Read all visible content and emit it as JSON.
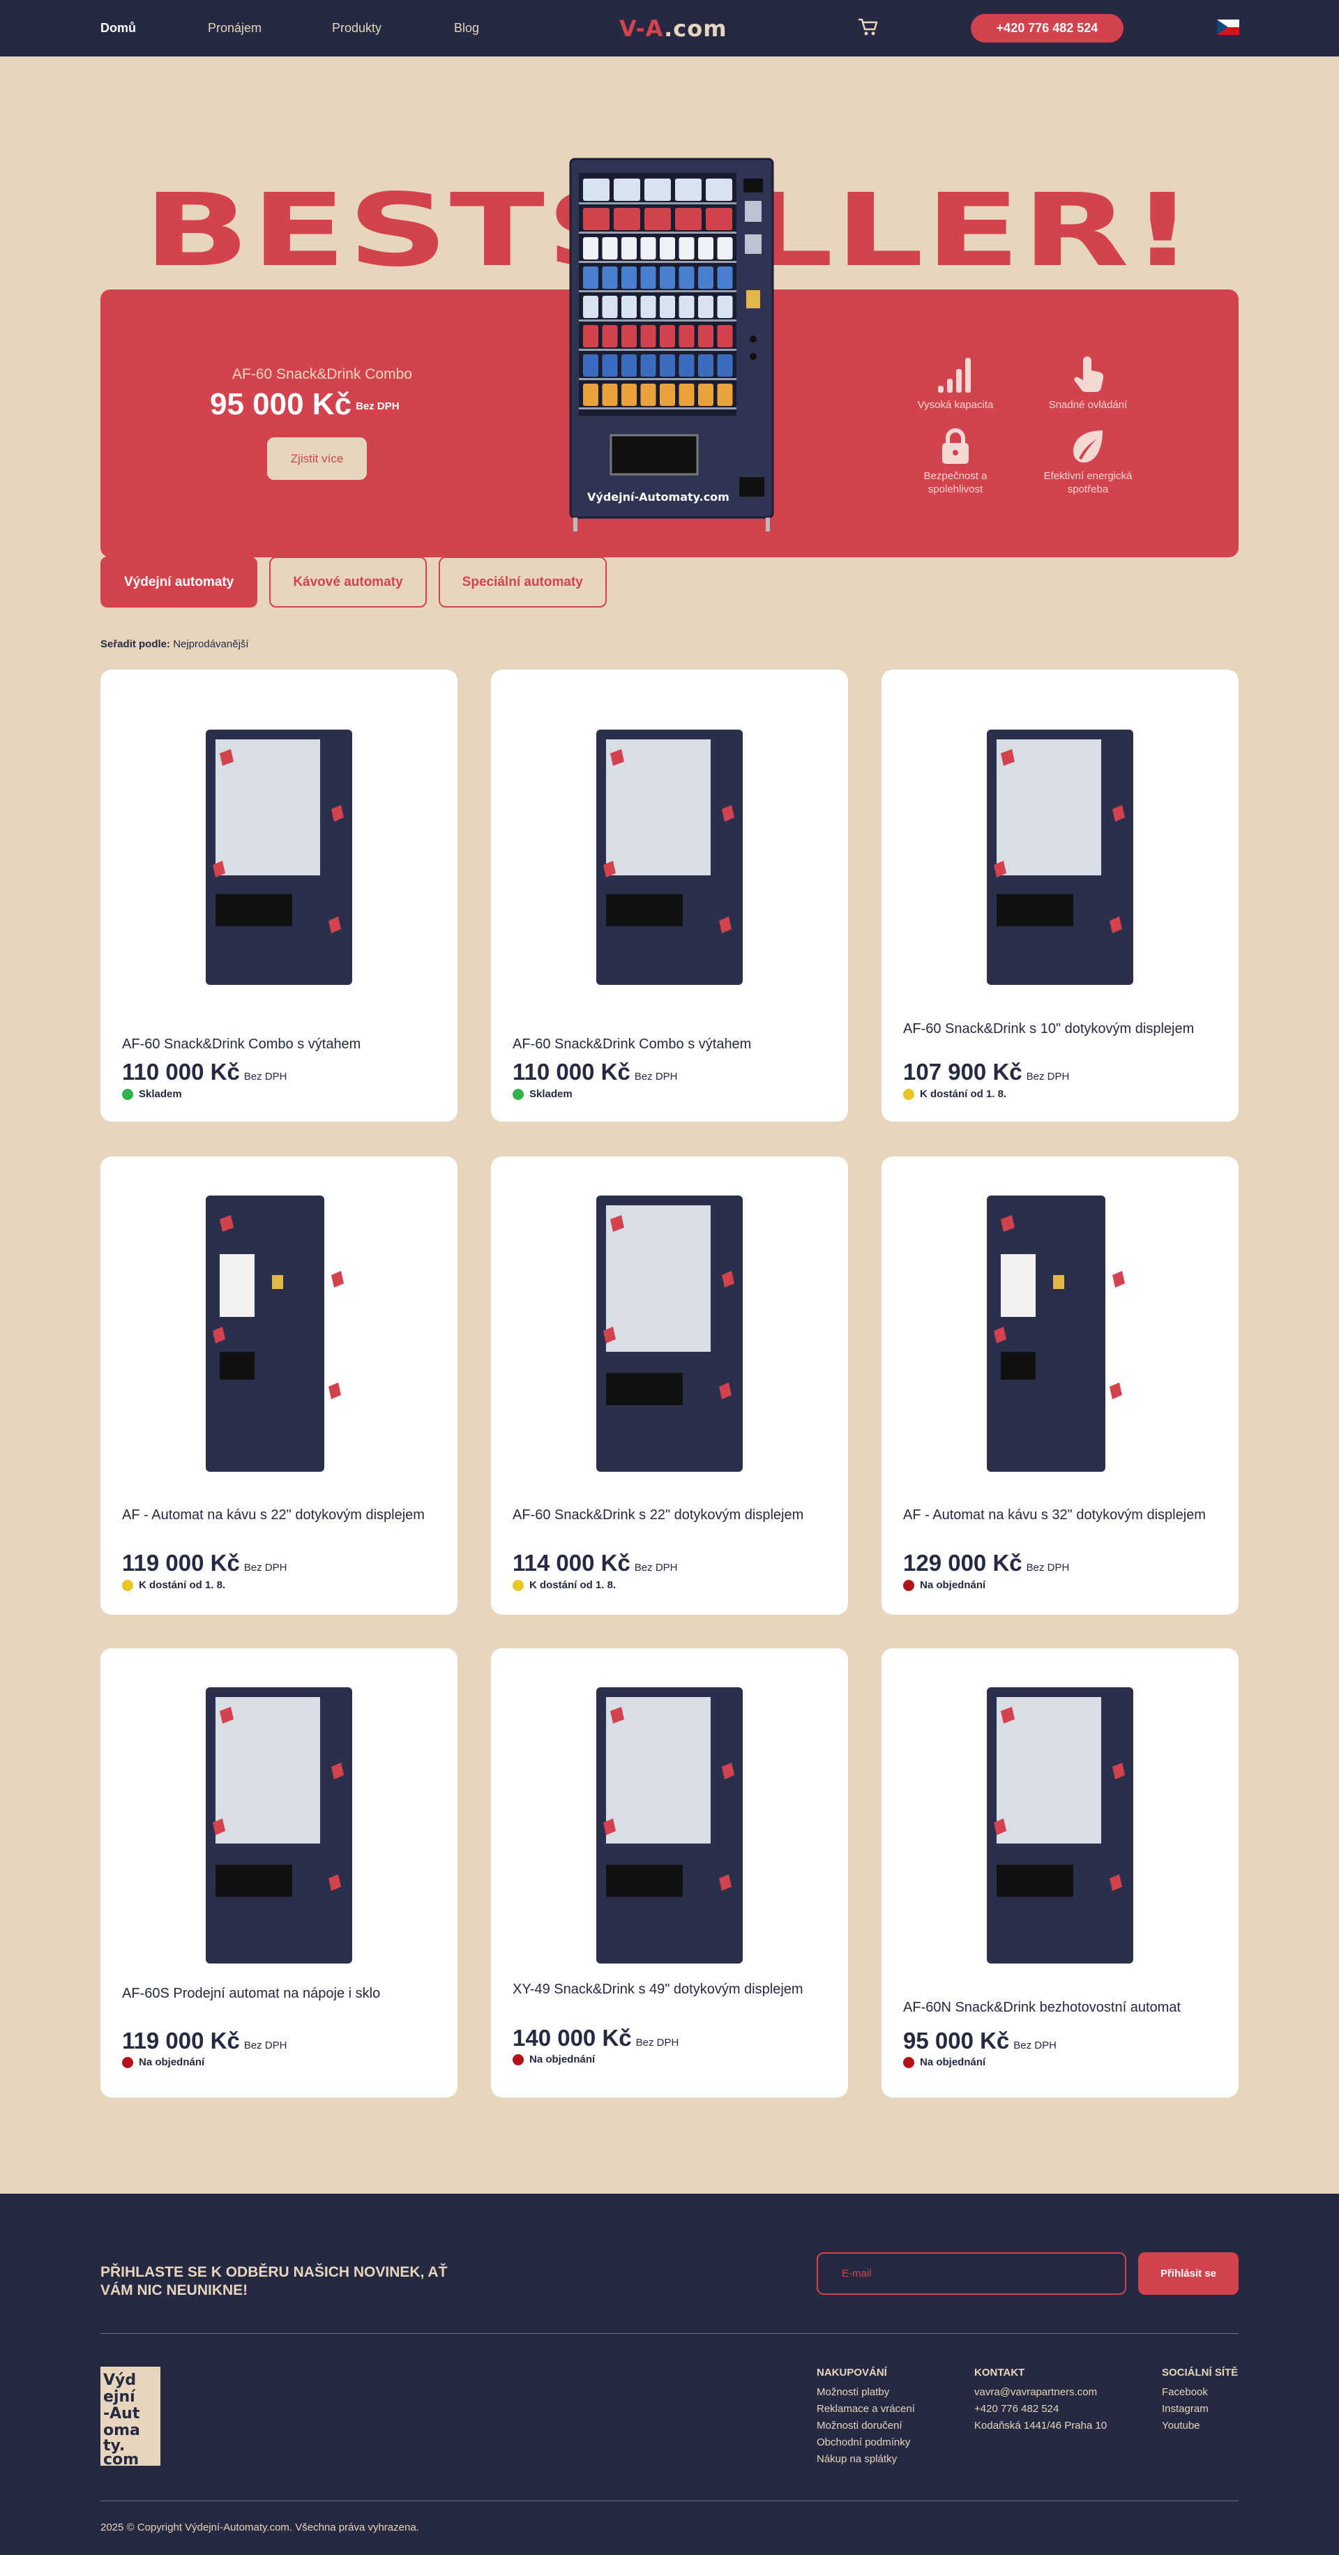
{
  "nav": {
    "links": [
      "Domů",
      "Pronájem",
      "Produkty",
      "Blog"
    ],
    "logo_left": "V-A",
    "logo_right": ".com",
    "phone": "+420 776 482 524",
    "cart_icon": "cart-icon",
    "flag_icon": "czech-flag-icon"
  },
  "hero": {
    "headline": "BESTSELLER!",
    "product_name": "AF-60 Snack&Drink Combo",
    "price": "95 000 Kč",
    "vat": "Bez DPH",
    "cta": "Zjistit více",
    "machine_brand": "Výdejní-Automaty.com",
    "features": [
      {
        "label": "Vysoká kapacita",
        "icon": "signal-bars-icon"
      },
      {
        "label": "Snadné ovládání",
        "icon": "touch-hand-icon"
      },
      {
        "label": "Bezpečnost a spolehlivost",
        "icon": "lock-icon"
      },
      {
        "label": "Efektivní energická spotřeba",
        "icon": "leaf-icon"
      }
    ]
  },
  "tabs": [
    "Výdejní automaty",
    "Kávové automaty",
    "Speciální automaty"
  ],
  "sort": {
    "label": "Seřadit podle:",
    "value": "Nejprodávanější"
  },
  "products": [
    {
      "title": "AF-60 Snack&Drink Combo s výtahem",
      "price": "110 000 Kč",
      "vat": "Bez DPH",
      "stock": "Skladem",
      "stock_color": "#2fb34a"
    },
    {
      "title": "AF-60 Snack&Drink Combo s výtahem",
      "price": "110 000 Kč",
      "vat": "Bez DPH",
      "stock": "Skladem",
      "stock_color": "#2fb34a"
    },
    {
      "title": "AF-60 Snack&Drink s 10\" dotykovým displejem",
      "price": "107 900 Kč",
      "vat": "Bez DPH",
      "stock": "K dostání od 1. 8.",
      "stock_color": "#e8c523"
    },
    {
      "title": "AF - Automat na kávu s 22\" dotykovým displejem",
      "price": "119 000 Kč",
      "vat": "Bez DPH",
      "stock": "K dostání od 1. 8.",
      "stock_color": "#e8c523"
    },
    {
      "title": "AF-60 Snack&Drink s 22\" dotykovým displejem",
      "price": "114 000 Kč",
      "vat": "Bez DPH",
      "stock": "K dostání od 1. 8.",
      "stock_color": "#e8c523"
    },
    {
      "title": "AF - Automat na kávu s 32\" dotykovým displejem",
      "price": "129 000 Kč",
      "vat": "Bez DPH",
      "stock": "Na objednání",
      "stock_color": "#b3121b"
    },
    {
      "title": "AF-60S Prodejní automat na nápoje i sklo",
      "price": "119 000 Kč",
      "vat": "Bez DPH",
      "stock": "Na objednání",
      "stock_color": "#b3121b"
    },
    {
      "title": "XY-49 Snack&Drink s 49\" dotykovým displejem",
      "price": "140 000 Kč",
      "vat": "Bez DPH",
      "stock": "Na objednání",
      "stock_color": "#b3121b"
    },
    {
      "title": "AF-60N Snack&Drink bezhotovostní automat",
      "price": "95 000 Kč",
      "vat": "Bez DPH",
      "stock": "Na objednání",
      "stock_color": "#b3121b"
    }
  ],
  "footer": {
    "newsletter": "PŘIHLASTE SE K ODBĚRU NAŠICH NOVINEK, AŤ VÁM NIC NEUNIKNE!",
    "email_placeholder": "E-mail",
    "subscribe": "Přihlásit se",
    "logo_text": "Výdejní-Automaty.com",
    "shopping": {
      "title": "NAKUPOVÁNÍ",
      "items": [
        "Možnosti platby",
        "Reklamace a vrácení",
        "Možnosti doručení",
        "Obchodní podmínky",
        "Nákup na splátky"
      ]
    },
    "contact": {
      "title": "KONTAKT",
      "items": [
        "vavra@vavrapartners.com",
        "+420 776 482 524",
        "Kodaňská 1441/46 Praha 10"
      ]
    },
    "social": {
      "title": "SOCIÁLNÍ SÍTĚ",
      "items": [
        "Facebook",
        "Instagram",
        "Youtube"
      ]
    },
    "copyright": "2025 © Copyright Výdejní-Automaty.com. Všechna práva vyhrazena."
  },
  "colors": {
    "navy": "#252a42",
    "red": "#d2434e",
    "beige": "#e8d5bd"
  }
}
